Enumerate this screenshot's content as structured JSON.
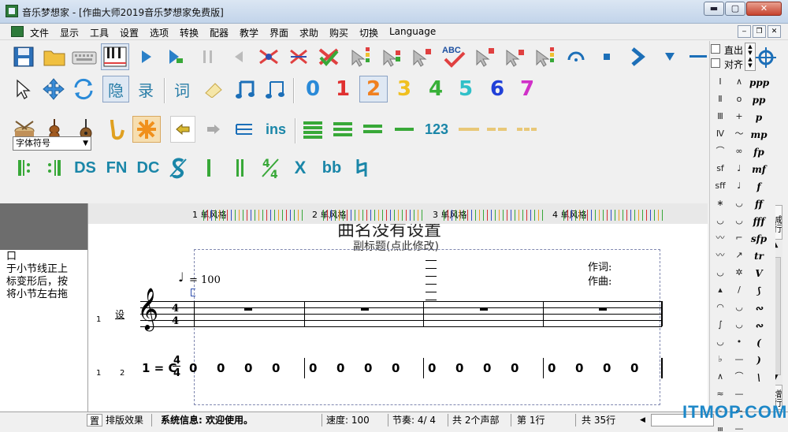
{
  "window": {
    "title": "音乐梦想家 - [作曲大师2019音乐梦想家免费版]",
    "min": "▬",
    "max": "▢",
    "close": "✕"
  },
  "menu": [
    "文件",
    "显示",
    "工具",
    "设置",
    "选项",
    "转换",
    "配器",
    "教学",
    "界面",
    "求助",
    "购买",
    "切换",
    "Language"
  ],
  "mdi": {
    "min": "‒",
    "restore": "❐",
    "close": "✕"
  },
  "toolbar_right": {
    "zhichu": "直出",
    "duiqi": "对齐"
  },
  "row2": {
    "yin": "隐",
    "lu": "录",
    "ci": "词",
    "nums": [
      "0",
      "1",
      "2",
      "3",
      "4",
      "5",
      "6",
      "7"
    ]
  },
  "row3": {
    "ins": "ins",
    "n123": "123"
  },
  "row4": {
    "ds": "DS",
    "fn": "FN",
    "dc": "DC",
    "x": "X",
    "bb": "bb",
    "s": "%",
    "quarter": "4"
  },
  "font_select": {
    "value": "字体符号"
  },
  "left_panel": {
    "text": "口\n于小节线正上\n标变形后，按\n将小节左右拖"
  },
  "ruler": [
    {
      "num": "1",
      "label": "单风格"
    },
    {
      "num": "2",
      "label": "单风格"
    },
    {
      "num": "3",
      "label": "单风格"
    },
    {
      "num": "4",
      "label": "单风格"
    }
  ],
  "score": {
    "title": "曲名没有设置",
    "subtitle": "副标题(点此修改)",
    "lyricist": "作词:",
    "composer": "作曲:",
    "tempo": "= 100",
    "row_labels": [
      "1",
      "1",
      "2"
    ],
    "instrument": "设",
    "key": "1 = C",
    "time_top": "4",
    "time_bottom": "4",
    "jianpu": [
      "0",
      "0",
      "0",
      "0",
      "0",
      "0",
      "0",
      "0",
      "0",
      "0",
      "0",
      "0",
      "0",
      "0",
      "0",
      "0"
    ]
  },
  "right_palette": {
    "col1": [
      "Ⅰ",
      "Ⅱ",
      "Ⅲ",
      "Ⅳ",
      "⌒",
      "sf",
      "sff",
      "∗",
      "◡",
      "〰",
      "〰",
      "◡",
      "▴",
      "◠",
      "∫",
      "◡",
      "♭",
      "∧",
      "≈",
      "♭",
      "Ⅲ"
    ],
    "col2": [
      "∧",
      "o",
      "+",
      "〜",
      "∞",
      "♩",
      "♩",
      "◡",
      "◡",
      "⌐",
      "↗",
      "✲",
      "/",
      "◡",
      "◡",
      "•",
      "—",
      "⌒",
      "—",
      "←",
      "—"
    ],
    "dynamics": [
      "ppp",
      "pp",
      "p",
      "mp",
      "fp",
      "mf",
      "f",
      "ff",
      "fff",
      "sfp",
      "tr",
      "V",
      "⟆",
      "∾",
      "∾",
      "(",
      ")",
      "\\"
    ]
  },
  "scroll_btns": {
    "reduce": "减行",
    "add": "增行"
  },
  "statusbar": {
    "tab1": "置",
    "tab2": "排版效果",
    "info": "系统信息: 欢迎使用。",
    "speed": "速度: 100",
    "beat": "节奏: 4/ 4",
    "voices": "共 2个声部",
    "line": "第 1行",
    "total": "共 35行"
  },
  "watermark": "ITMOP.COM"
}
